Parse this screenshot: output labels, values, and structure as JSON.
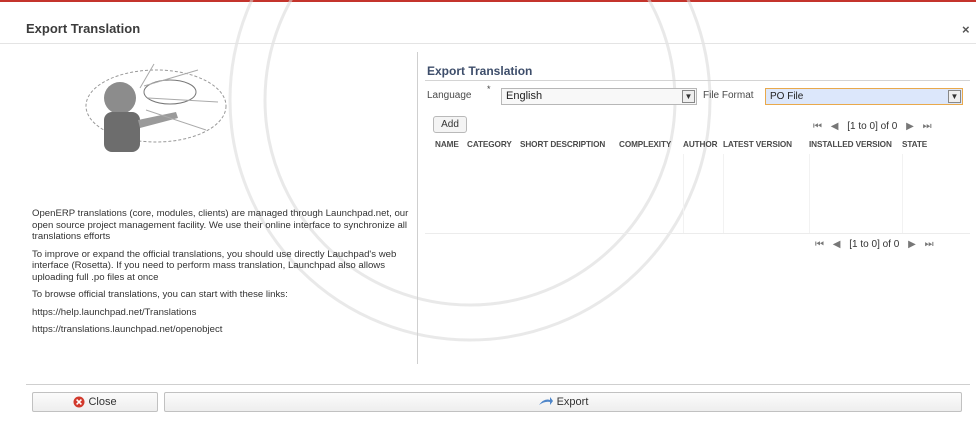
{
  "dialog": {
    "title": "Export Translation",
    "close_icon": "close-icon"
  },
  "info": {
    "paragraphs": [
      "OpenERP translations (core, modules, clients) are managed through Launchpad.net, our open source project management facility. We use their online interface to synchronize all translations efforts",
      "To improve or expand the official translations, you should use directly Lauchpad's web interface (Rosetta). If you need to perform mass translation, Launchpad also allows uploading full .po files at once",
      "To browse official translations, you can start with these links:"
    ],
    "links": [
      "https://help.launchpad.net/Translations",
      "https://translations.launchpad.net/openobject"
    ]
  },
  "form": {
    "section_title": "Export Translation",
    "language_label": "Language",
    "required_mark": "*",
    "language_value": "English",
    "file_format_label": "File Format",
    "file_format_value": "PO File",
    "add_label": "Add"
  },
  "grid": {
    "columns": [
      "NAME",
      "CATEGORY",
      "SHORT DESCRIPTION",
      "COMPLEXITY",
      "AUTHOR",
      "LATEST VERSION",
      "INSTALLED VERSION",
      "STATE"
    ],
    "pager_text": "[1 to 0] of 0",
    "rows": []
  },
  "footer": {
    "close_label": "Close",
    "export_label": "Export"
  },
  "colors": {
    "accent_red": "#c4342c",
    "title_blue": "#3d4d6a",
    "file_format_bg": "#dce7fb"
  }
}
